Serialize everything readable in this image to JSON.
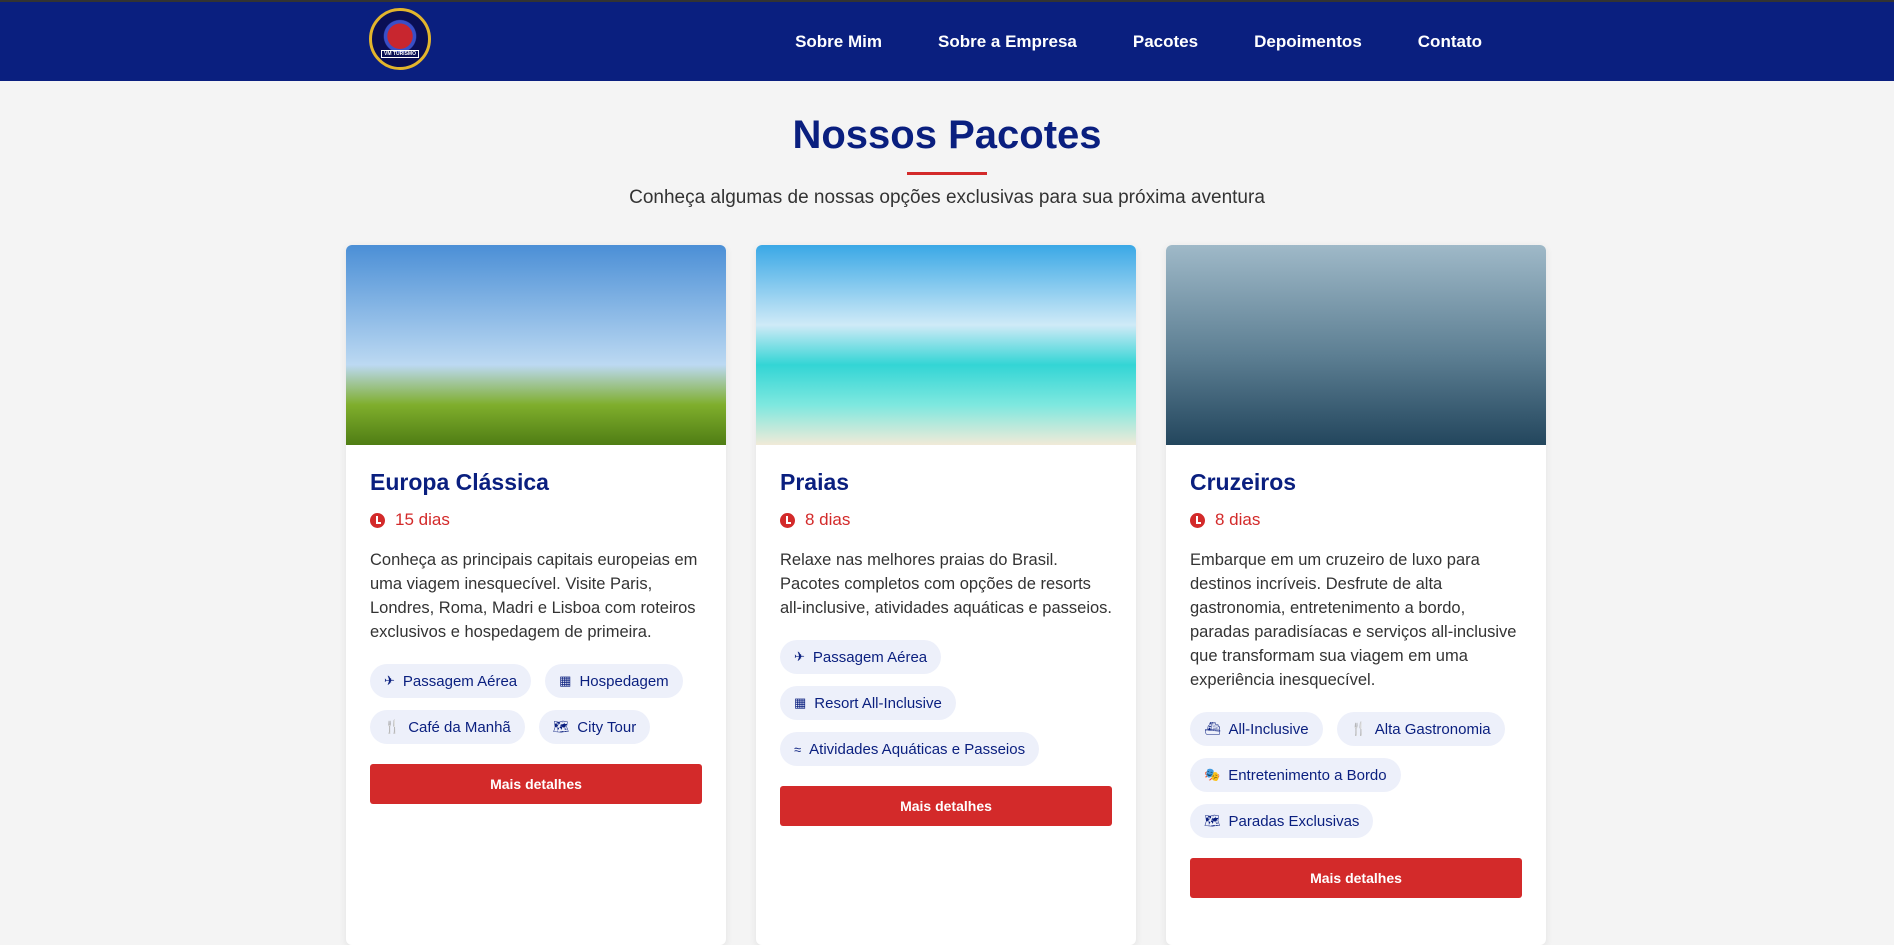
{
  "header": {
    "logo_text": "VM TURISMO",
    "nav": [
      "Sobre Mim",
      "Sobre a Empresa",
      "Pacotes",
      "Depoimentos",
      "Contato"
    ]
  },
  "section": {
    "title": "Nossos Pacotes",
    "subtitle": "Conheça algumas de nossas opções exclusivas para sua próxima aventura"
  },
  "cards": [
    {
      "title": "Europa Clássica",
      "duration": "15 dias",
      "description": "Conheça as principais capitais europeias em uma viagem inesquecível. Visite Paris, Londres, Roma, Madri e Lisboa com roteiros exclusivos e hospedagem de primeira.",
      "tags": [
        {
          "icon": "✈",
          "label": "Passagem Aérea"
        },
        {
          "icon": "▦",
          "label": "Hospedagem"
        },
        {
          "icon": "🍴",
          "label": "Café da Manhã"
        },
        {
          "icon": "🗺",
          "label": "City Tour"
        }
      ],
      "button": "Mais detalhes"
    },
    {
      "title": "Praias",
      "duration": "8 dias",
      "description": "Relaxe nas melhores praias do Brasil. Pacotes completos com opções de resorts all-inclusive, atividades aquáticas e passeios.",
      "tags": [
        {
          "icon": "✈",
          "label": "Passagem Aérea"
        },
        {
          "icon": "▦",
          "label": "Resort All-Inclusive"
        },
        {
          "icon": "≈",
          "label": "Atividades Aquáticas e Passeios"
        }
      ],
      "button": "Mais detalhes"
    },
    {
      "title": "Cruzeiros",
      "duration": "8 dias",
      "description": "Embarque em um cruzeiro de luxo para destinos incríveis. Desfrute de alta gastronomia, entretenimento a bordo, paradas paradisíacas e serviços all-inclusive que transformam sua viagem em uma experiência inesquecível.",
      "tags": [
        {
          "icon": "⛴",
          "label": "All-Inclusive"
        },
        {
          "icon": "🍴",
          "label": "Alta Gastronomia"
        },
        {
          "icon": "🎭",
          "label": "Entretenimento a Bordo"
        },
        {
          "icon": "🗺",
          "label": "Paradas Exclusivas"
        }
      ],
      "button": "Mais detalhes"
    }
  ]
}
